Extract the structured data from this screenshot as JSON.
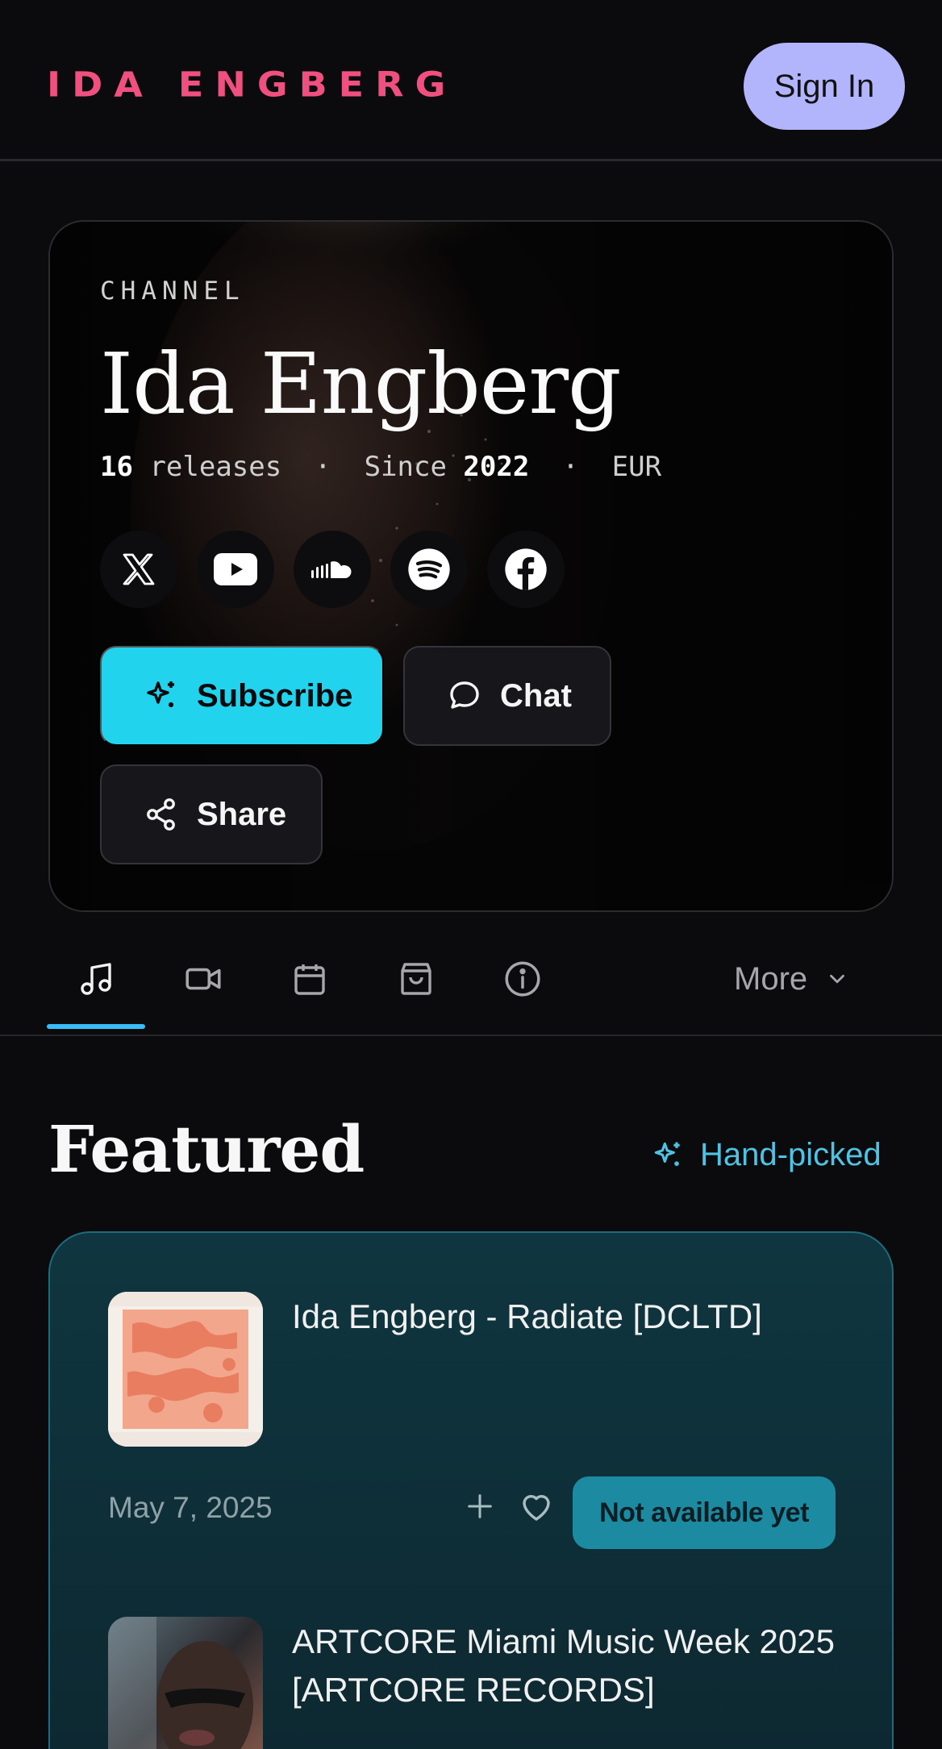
{
  "header": {
    "logo_text": "IDA ENGBERG",
    "signin_label": "Sign In"
  },
  "hero": {
    "eyebrow": "CHANNEL",
    "title": "Ida Engberg",
    "releases_count": "16",
    "releases_label": "releases",
    "since_label": "Since",
    "since_year": "2022",
    "currency": "EUR",
    "socials": [
      "x-icon",
      "youtube-icon",
      "soundcloud-icon",
      "spotify-icon",
      "facebook-icon"
    ],
    "subscribe_label": "Subscribe",
    "chat_label": "Chat",
    "share_label": "Share"
  },
  "tabs": {
    "items": [
      "music-icon",
      "video-icon",
      "calendar-icon",
      "shop-icon",
      "info-icon"
    ],
    "active": "music-icon",
    "more_label": "More"
  },
  "featured": {
    "title": "Featured",
    "badge_label": "Hand-picked",
    "items": [
      {
        "title": "Ida Engberg - Radiate [DCLTD]",
        "date": "May 7, 2025",
        "status": "Not available yet"
      },
      {
        "title": "ARTCORE Miami Music Week 2025 [ARTCORE RECORDS]"
      }
    ]
  },
  "colors": {
    "accent": "#22d3ee",
    "logo": "#f0507f",
    "signin": "#b2b5fb",
    "featured_card": "#0f3640",
    "status_badge": "#1c8ba2"
  }
}
